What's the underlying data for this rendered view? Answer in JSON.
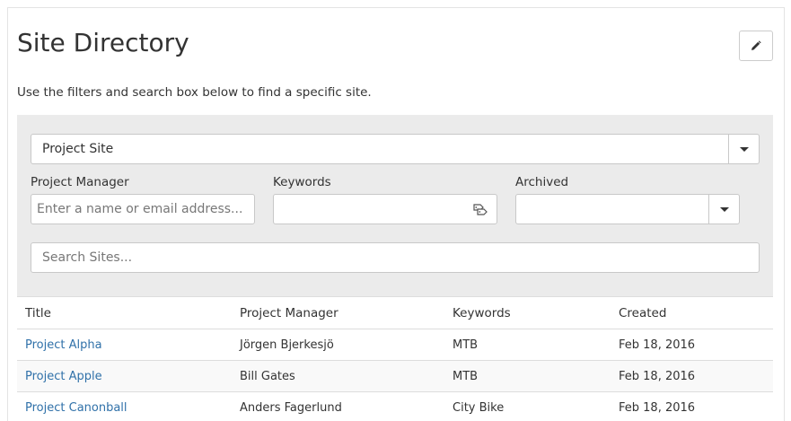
{
  "page": {
    "title": "Site Directory",
    "subtitle": "Use the filters and search box below to find a specific site."
  },
  "filters": {
    "site_type": {
      "value": "Project Site"
    },
    "project_manager": {
      "label": "Project Manager",
      "placeholder": "Enter a name or email address..."
    },
    "keywords": {
      "label": "Keywords",
      "value": ""
    },
    "archived": {
      "label": "Archived",
      "value": ""
    },
    "search": {
      "placeholder": "Search Sites..."
    }
  },
  "table": {
    "headers": {
      "title": "Title",
      "project_manager": "Project Manager",
      "keywords": "Keywords",
      "created": "Created"
    },
    "rows": [
      {
        "title": "Project Alpha",
        "project_manager": "Jörgen Bjerkesjö",
        "keywords": "MTB",
        "created": "Feb 18, 2016"
      },
      {
        "title": "Project Apple",
        "project_manager": "Bill Gates",
        "keywords": "MTB",
        "created": "Feb 18, 2016"
      },
      {
        "title": "Project Canonball",
        "project_manager": "Anders Fagerlund",
        "keywords": "City Bike",
        "created": "Feb 18, 2016"
      }
    ]
  },
  "icons": {
    "edit": "pencil-icon",
    "keywords_picker": "tags-icon",
    "dropdown": "caret-down-icon"
  },
  "colors": {
    "link": "#3071a9",
    "filter_background": "#ebebeb",
    "border": "#c8c8c8"
  }
}
